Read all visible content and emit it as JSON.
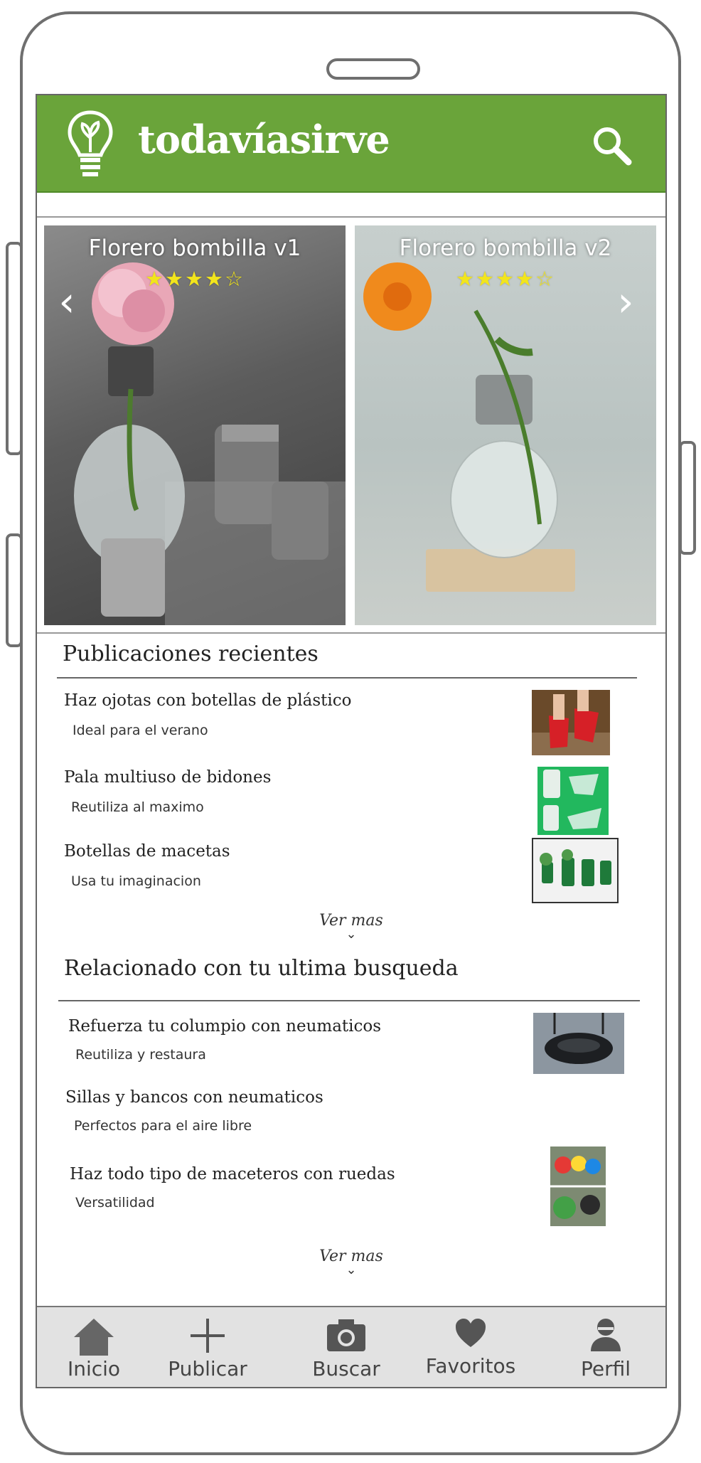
{
  "app": {
    "title": "todavíasirve",
    "brand_color": "#6aa43a",
    "logo_icon": "lightbulb-icon",
    "search_icon": "search-icon"
  },
  "carousel": {
    "prev_label": "‹",
    "next_label": "›",
    "cards": [
      {
        "title": "Florero bombilla v1",
        "rating": 4,
        "max_rating": 5,
        "stars": "★★★★☆"
      },
      {
        "title": "Florero bombilla v2",
        "rating": 4,
        "max_rating": 5,
        "stars": "★★★★☆"
      }
    ]
  },
  "recent": {
    "title": "Publicaciones recientes",
    "more_label": "Ver mas",
    "items": [
      {
        "title": "Haz ojotas con botellas de plástico",
        "subtitle": "Ideal para el verano"
      },
      {
        "title": "Pala multiuso de bidones",
        "subtitle": "Reutiliza al maximo"
      },
      {
        "title": "Botellas de macetas",
        "subtitle": "Usa tu imaginacion"
      }
    ]
  },
  "related": {
    "title": "Relacionado con tu ultima busqueda",
    "more_label": "Ver mas",
    "items": [
      {
        "title": "Refuerza tu columpio con neumaticos",
        "subtitle": "Reutiliza y restaura"
      },
      {
        "title": "Sillas y bancos con neumaticos",
        "subtitle": "Perfectos para el aire libre"
      },
      {
        "title": "Haz todo tipo de maceteros con ruedas",
        "subtitle": "Versatilidad"
      }
    ]
  },
  "nav": {
    "items": [
      {
        "label": "Inicio",
        "icon": "home-icon"
      },
      {
        "label": "Publicar",
        "icon": "plus-icon"
      },
      {
        "label": "Buscar",
        "icon": "camera-icon"
      },
      {
        "label": "Favoritos",
        "icon": "heart-icon"
      },
      {
        "label": "Perfil",
        "icon": "user-icon"
      }
    ]
  }
}
